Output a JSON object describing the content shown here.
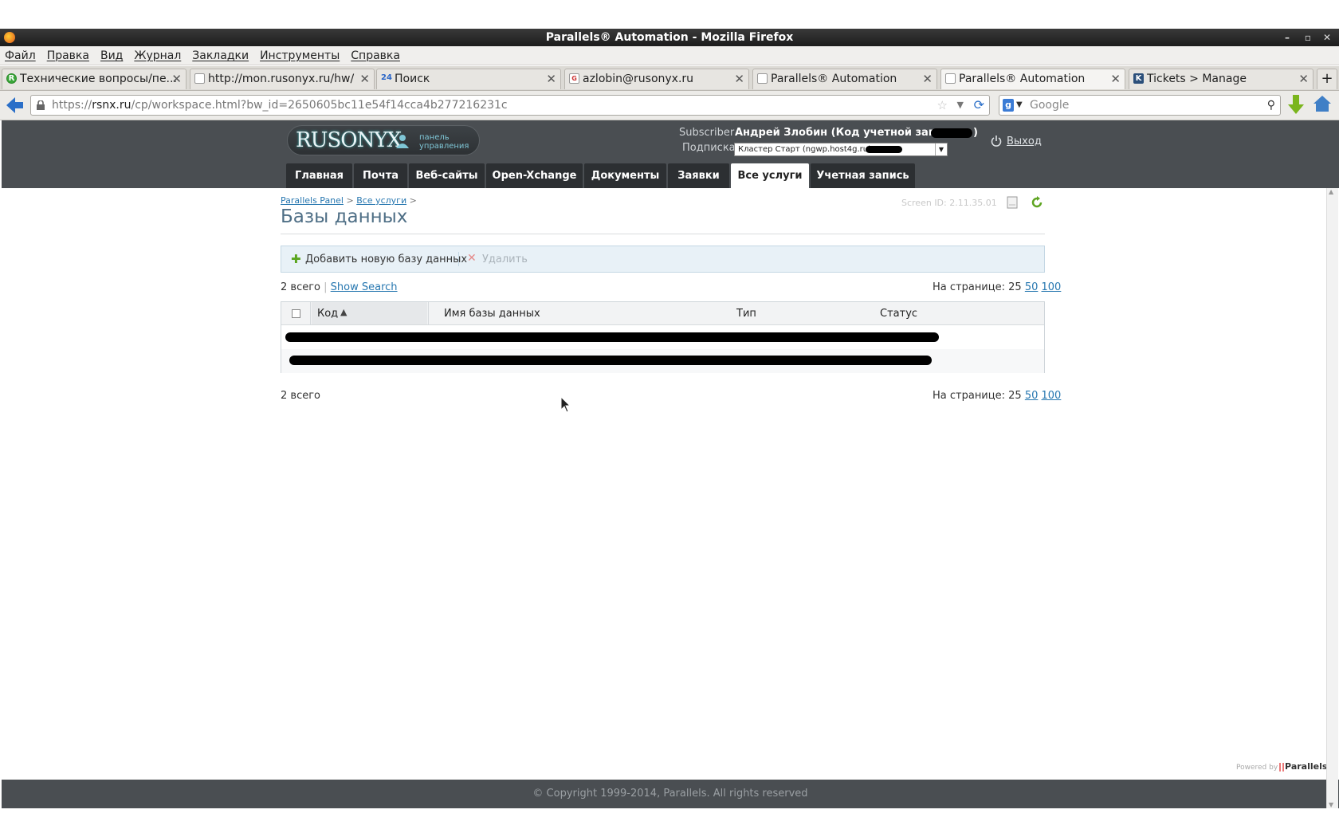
{
  "window": {
    "title": "Parallels® Automation - Mozilla Firefox",
    "controls": [
      "–",
      "▫",
      "✕"
    ]
  },
  "menu": [
    "Файл",
    "Правка",
    "Вид",
    "Журнал",
    "Закладки",
    "Инструменты",
    "Справка"
  ],
  "tabs": [
    {
      "label": "Технические вопросы/пе...",
      "icon": "R"
    },
    {
      "label": "http://mon.rusonyx.ru/hw/",
      "icon": ""
    },
    {
      "label": "Поиск",
      "icon": "24"
    },
    {
      "label": "azlobin@rusonyx.ru",
      "icon": "G"
    },
    {
      "label": "Parallels® Automation",
      "icon": ""
    },
    {
      "label": "Parallels® Automation",
      "icon": ""
    },
    {
      "label": "Tickets > Manage",
      "icon": "K"
    }
  ],
  "tab_close": "✕",
  "new_tab": "+",
  "url": {
    "scheme": "https://",
    "host": "rsnx.ru",
    "path": "/cp/workspace.html?bw_id=2650605bc11e54f14cca4b277216231c"
  },
  "search": {
    "placeholder": "Google",
    "engine": "g"
  },
  "brand": {
    "logo": "RUSONYX",
    "tagline_1": "панель",
    "tagline_2": "управления"
  },
  "account": {
    "subscriber_label": "Subscriber",
    "subscriber_name": "Андрей Злобин (Код учетной записи:",
    "subscriber_close": ")",
    "subscription_label": "Подписка",
    "subscription_value": "Кластер Старт (ngwp.host4g.ru):",
    "logout": "Выход"
  },
  "nav_tabs": [
    "Главная",
    "Почта",
    "Веб-сайты",
    "Open-Xchange",
    "Документы",
    "Заявки",
    "Все услуги",
    "Учетная запись"
  ],
  "breadcrumb": {
    "item1": "Parallels Panel",
    "item2": "Все услуги",
    "sep": ">"
  },
  "screen_id": "Screen ID: 2.11.35.01",
  "page_title": "Базы данных",
  "toolbar": {
    "add": "Добавить новую базу данных",
    "delete": "Удалить"
  },
  "list": {
    "total_top": "2 всего",
    "show_search": "Show Search",
    "per_page_label": "На странице:",
    "per_page_options": [
      "25",
      "50",
      "100"
    ],
    "total_bottom": "2 всего"
  },
  "table": {
    "columns": [
      "Код",
      "Имя базы данных",
      "Тип",
      "Статус"
    ],
    "rows": [
      {
        "code": "",
        "name": "",
        "type": "",
        "status": ""
      },
      {
        "code": "",
        "name": "",
        "type": "",
        "status": ""
      }
    ]
  },
  "powered_by": {
    "label": "Powered by",
    "brand": "Parallels"
  },
  "copyright": "© Copyright 1999-2014, Parallels. All rights reserved",
  "colors": {
    "header_bg": "#4a4e52",
    "nav_tab_bg": "#2c2f32",
    "link": "#2777b0",
    "toolbar_bg": "#e8f1f7",
    "title": "#4f6f86"
  }
}
